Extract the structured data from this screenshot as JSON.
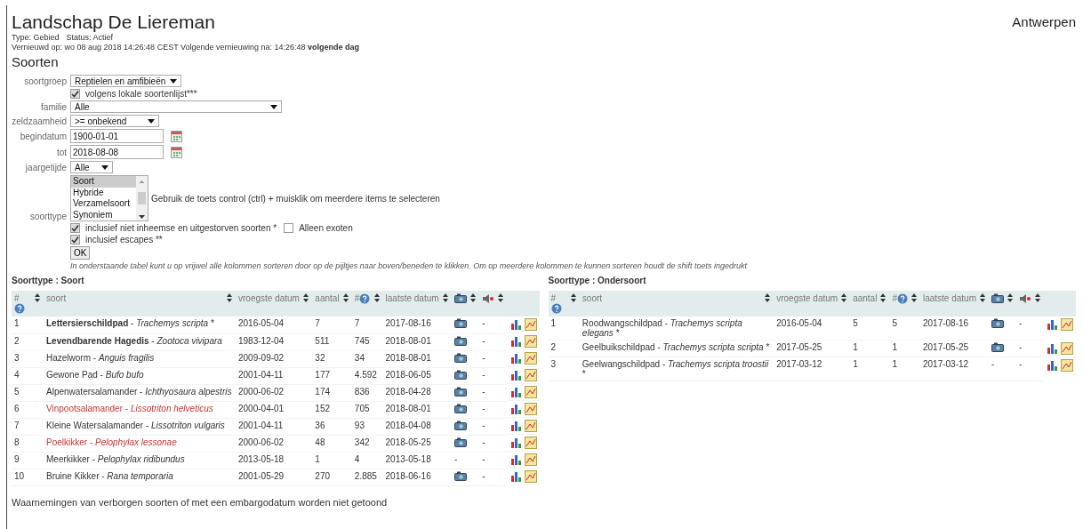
{
  "header": {
    "title": "Landschap De Liereman",
    "region": "Antwerpen",
    "type": "Type: Gebied",
    "status": "Status: Actief",
    "refresh": "Vernieuwd op: wo 08 aug 2018 14:26:48 CEST Volgende vernieuwing na: 14:26:48 **volgende dag**"
  },
  "section_title": "Soorten",
  "form": {
    "soortgroep": {
      "label": "soortgroep",
      "value": "Reptielen en amfibieën"
    },
    "lokale_lijst": {
      "label": "volgens lokale soortenlijst***",
      "checked": true
    },
    "familie": {
      "label": "familie",
      "value": "Alle"
    },
    "zeldzaamheid": {
      "label": "zeldzaamheid",
      "value": ">= onbekend"
    },
    "begindatum": {
      "label": "begindatum",
      "value": "1900-01-01"
    },
    "tot": {
      "label": "tot",
      "value": "2018-08-08"
    },
    "jaargetijde": {
      "label": "jaargetijde",
      "value": "Alle"
    },
    "soorttype": {
      "label": "soorttype",
      "options": [
        {
          "label": "Soort",
          "selected": true
        },
        {
          "label": "Hybride",
          "selected": false
        },
        {
          "label": "Verzamelsoort",
          "selected": false
        },
        {
          "label": "Synoniem",
          "selected": false
        }
      ],
      "hint": "Gebruik de toets control (ctrl) + muisklik om meerdere items te selecteren"
    },
    "niet_inheems": {
      "label": "inclusief niet inheemse en uitgestorven soorten *",
      "checked": true
    },
    "exoten": {
      "label": "Alleen exoten",
      "checked": false
    },
    "escapes": {
      "label": "inclusief escapes **",
      "checked": true
    },
    "ok": "OK",
    "note": "In onderstaande tabel kunt u op vrijwel alle kolommen sorteren door op de pijltjes naar boven/beneden te klikken. Om op meerdere kolommen te kunnen sorteren houdt de shift toets ingedrukt"
  },
  "tables": [
    {
      "title": "Soorttype : Soort",
      "columns": [
        "#",
        "soort",
        "vroegste datum",
        "aantal",
        "#",
        "laatste datum"
      ],
      "rows": [
        {
          "n": "1",
          "name": "**Lettersierschildpad** - *Trachemys scripta* *",
          "flagged": false,
          "first": "2016-05-04",
          "count": "7",
          "obs": "7",
          "last": "2017-08-16",
          "photo": true,
          "photo_text": "",
          "sound": "-"
        },
        {
          "n": "2",
          "name": "**Levendbarende Hagedis** - *Zootoca vivipara*",
          "flagged": false,
          "first": "1983-12-04",
          "count": "511",
          "obs": "745",
          "last": "2018-08-01",
          "photo": true,
          "photo_text": "",
          "sound": "-"
        },
        {
          "n": "3",
          "name": "Hazelworm - *Anguis fragilis*",
          "flagged": false,
          "first": "2009-09-02",
          "count": "32",
          "obs": "34",
          "last": "2018-08-01",
          "photo": true,
          "photo_text": "",
          "sound": "-"
        },
        {
          "n": "4",
          "name": "Gewone Pad - *Bufo bufo*",
          "flagged": false,
          "first": "2001-04-11",
          "count": "177",
          "obs": "4.592",
          "last": "2018-06-05",
          "photo": true,
          "photo_text": "",
          "sound": "-"
        },
        {
          "n": "5",
          "name": "Alpenwatersalamander - *Ichthyosaura alpestris*",
          "flagged": false,
          "first": "2000-06-02",
          "count": "174",
          "obs": "836",
          "last": "2018-04-28",
          "photo": true,
          "photo_text": "",
          "sound": "-"
        },
        {
          "n": "6",
          "name": "Vinpootsalamander - *Lissotriton helveticus*",
          "flagged": true,
          "first": "2000-04-01",
          "count": "152",
          "obs": "705",
          "last": "2018-08-01",
          "photo": true,
          "photo_text": "",
          "sound": "-"
        },
        {
          "n": "7",
          "name": "Kleine Watersalamander - *Lissotriton vulgaris*",
          "flagged": false,
          "first": "2001-04-11",
          "count": "36",
          "obs": "93",
          "last": "2018-04-08",
          "photo": true,
          "photo_text": "",
          "sound": "-"
        },
        {
          "n": "8",
          "name": "Poelkikker - *Pelophylax lessonae*",
          "flagged": true,
          "first": "2000-06-02",
          "count": "48",
          "obs": "342",
          "last": "2018-05-25",
          "photo": true,
          "photo_text": "",
          "sound": "-"
        },
        {
          "n": "9",
          "name": "Meerkikker - *Pelophylax ridibundus*",
          "flagged": false,
          "first": "2013-05-18",
          "count": "1",
          "obs": "4",
          "last": "2013-05-18",
          "photo": false,
          "photo_text": "-",
          "sound": "-"
        },
        {
          "n": "10",
          "name": "Bruine Kikker - *Rana temporaria*",
          "flagged": false,
          "first": "2001-05-29",
          "count": "270",
          "obs": "2.885",
          "last": "2018-06-16",
          "photo": true,
          "photo_text": "",
          "sound": "-"
        }
      ]
    },
    {
      "title": "Soorttype : Ondersoort",
      "columns": [
        "#",
        "soort",
        "vroegste datum",
        "aantal",
        "#",
        "laatste datum"
      ],
      "rows": [
        {
          "n": "1",
          "name": "Roodwangschildpad - *Trachemys scripta elegans* *",
          "flagged": false,
          "first": "2016-05-04",
          "count": "5",
          "obs": "5",
          "last": "2017-08-16",
          "photo": true,
          "photo_text": "",
          "sound": "-"
        },
        {
          "n": "2",
          "name": "Geelbuikschildpad - *Trachemys scripta scripta* *",
          "flagged": false,
          "first": "2017-05-25",
          "count": "1",
          "obs": "1",
          "last": "2017-05-25",
          "photo": true,
          "photo_text": "",
          "sound": "-"
        },
        {
          "n": "3",
          "name": "Geelwangschildpad - *Trachemys scripta troostii* *",
          "flagged": false,
          "first": "2017-03-12",
          "count": "1",
          "obs": "1",
          "last": "2017-03-12",
          "photo": false,
          "photo_text": "-",
          "sound": "-"
        }
      ]
    }
  ],
  "footer": "Waarnemingen van verborgen soorten of met een embargodatum worden niet getoond"
}
